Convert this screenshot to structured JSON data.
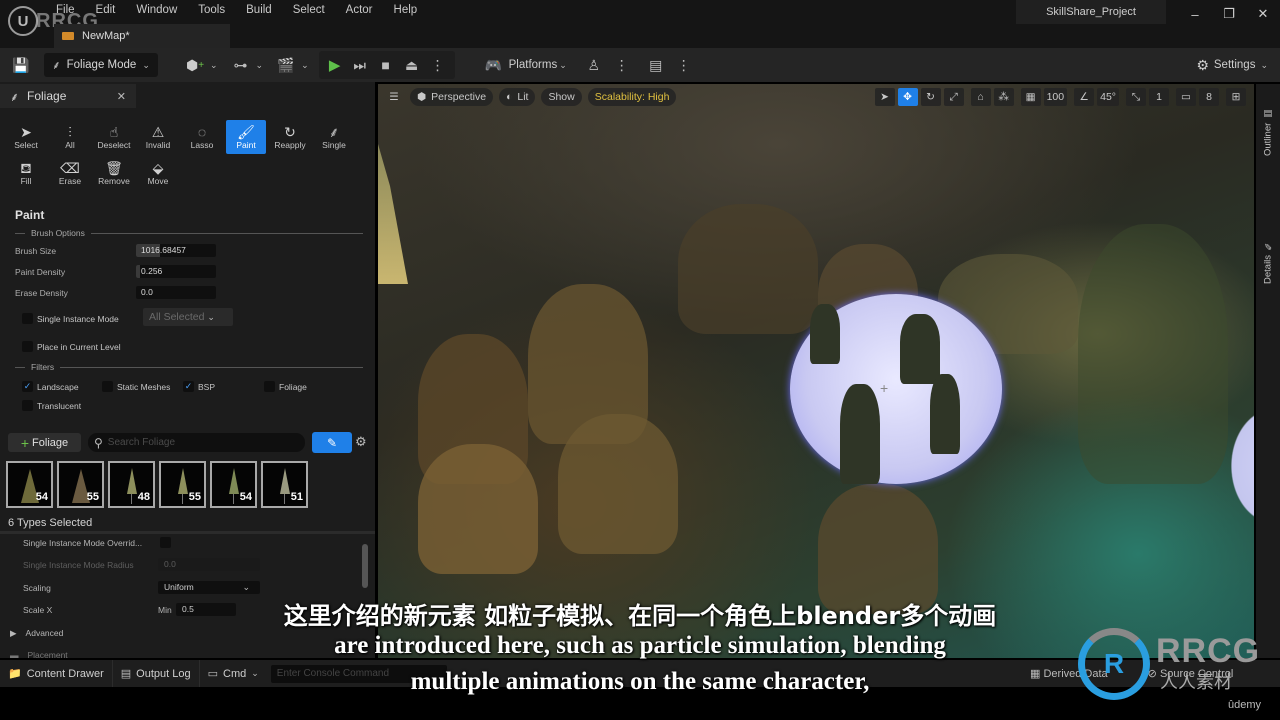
{
  "menu": [
    "File",
    "Edit",
    "Window",
    "Tools",
    "Build",
    "Select",
    "Actor",
    "Help"
  ],
  "map_tab": "NewMap*",
  "project_name": "SkillShare_Project",
  "window_buttons": {
    "minimize": "–",
    "restore": "❐",
    "close": "✕"
  },
  "toolbar": {
    "mode": "Foliage Mode",
    "platforms": "Platforms",
    "settings": "Settings"
  },
  "foliage_panel": {
    "tab_title": "Foliage",
    "tools_row1": [
      {
        "label": "Select",
        "icon": "arrow-icon"
      },
      {
        "label": "All",
        "icon": "select-all-icon"
      },
      {
        "label": "Deselect",
        "icon": "deselect-icon"
      },
      {
        "label": "Invalid",
        "icon": "invalid-icon"
      },
      {
        "label": "Lasso",
        "icon": "lasso-icon"
      },
      {
        "label": "Paint",
        "icon": "brush-icon",
        "active": true
      },
      {
        "label": "Reapply",
        "icon": "reapply-icon"
      },
      {
        "label": "Single",
        "icon": "single-icon"
      }
    ],
    "tools_row2": [
      {
        "label": "Fill",
        "icon": "fill-icon"
      },
      {
        "label": "Erase",
        "icon": "eraser-icon"
      },
      {
        "label": "Remove",
        "icon": "trash-icon"
      },
      {
        "label": "Move",
        "icon": "move-icon"
      }
    ],
    "paint_title": "Paint",
    "brush_options_label": "Brush Options",
    "brush_size_label": "Brush Size",
    "brush_size_value": "1016.68457",
    "paint_density_label": "Paint Density",
    "paint_density_value": "0.256",
    "erase_density_label": "Erase Density",
    "erase_density_value": "0.0",
    "single_instance_label": "Single Instance Mode",
    "single_instance_dropdown": "All Selected",
    "place_current_level_label": "Place in Current Level",
    "filters_label": "Filters",
    "filters": [
      {
        "label": "Landscape",
        "checked": true
      },
      {
        "label": "Static Meshes",
        "checked": false
      },
      {
        "label": "BSP",
        "checked": true
      },
      {
        "label": "Foliage",
        "checked": false
      },
      {
        "label": "Translucent",
        "checked": false
      }
    ],
    "add_foliage_label": "Foliage",
    "search_placeholder": "Search Foliage",
    "foliage_types": [
      {
        "count": "54"
      },
      {
        "count": "55"
      },
      {
        "count": "48"
      },
      {
        "count": "55"
      },
      {
        "count": "54"
      },
      {
        "count": "51"
      }
    ],
    "types_selected": "6 Types Selected",
    "details": {
      "single_override_label": "Single Instance Mode Overrid...",
      "single_radius_label": "Single Instance Mode Radius",
      "single_radius_value": "0.0",
      "scaling_label": "Scaling",
      "scaling_value": "Uniform",
      "scale_x_label": "Scale X",
      "min_label": "Min",
      "min_value": "0.5",
      "advanced_label": "Advanced",
      "placement_label": "Placement"
    }
  },
  "viewport": {
    "perspective": "Perspective",
    "lit": "Lit",
    "show": "Show",
    "scalability": "Scalability: High",
    "grid_snap": "100",
    "rotation_snap": "45°",
    "scale_snap": "1",
    "camera_speed": "8"
  },
  "right_tabs": {
    "outliner": "Outliner",
    "details": "Details"
  },
  "statusbar": {
    "content_drawer": "Content Drawer",
    "output_log": "Output Log",
    "cmd": "Cmd",
    "console_placeholder": "Enter Console Command",
    "derived_data": "Derived Data",
    "source_control": "Source Control"
  },
  "subtitles": {
    "zh": "这里介绍的新元素 如粒子模拟、在同一个角色上blender多个动画",
    "en_line1": "are introduced here, such as particle simulation, blending",
    "en_line2": "multiple animations on the same character,"
  },
  "watermark": {
    "corner": "RRCG",
    "brand": "RRCG",
    "brand_sub": "人人素材",
    "udemy": "ûdemy"
  }
}
